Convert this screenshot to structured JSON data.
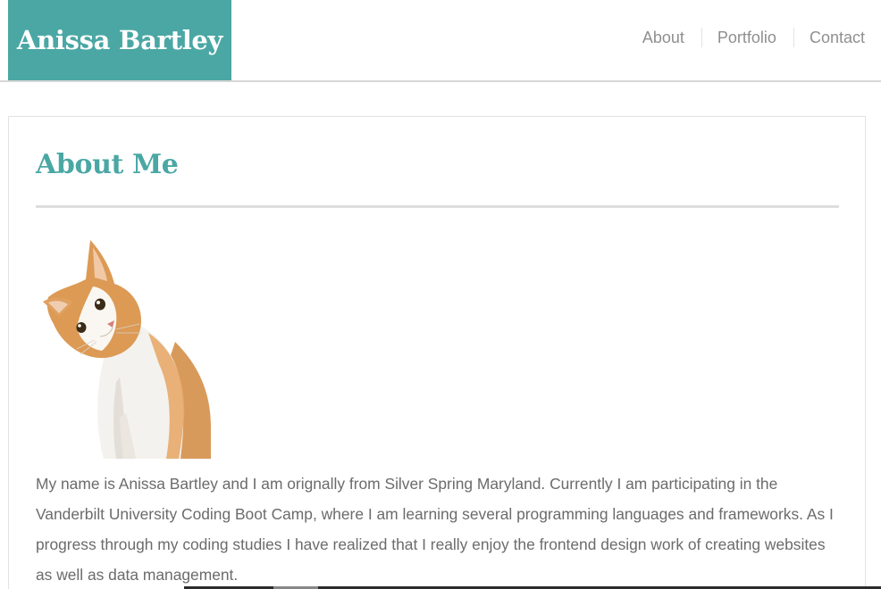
{
  "header": {
    "brand": "Anissa Bartley",
    "nav": [
      {
        "label": "About"
      },
      {
        "label": "Portfolio"
      },
      {
        "label": "Contact"
      }
    ]
  },
  "about": {
    "title": "About Me",
    "photo_icon": "cat-photo",
    "bio": "My name is Anissa Bartley and I am orignally from Silver Spring Maryland. Currently I am participating in the Vanderbilt University Coding Boot Camp, where I am learning several programming languages and frameworks. As I progress through my coding studies I have realized that I really enjoy the frontend design work of creating websites as well as data management."
  },
  "colors": {
    "accent": "#4aa7a4",
    "nav_text": "#8f8f8f",
    "body_text": "#6b6b6b"
  }
}
